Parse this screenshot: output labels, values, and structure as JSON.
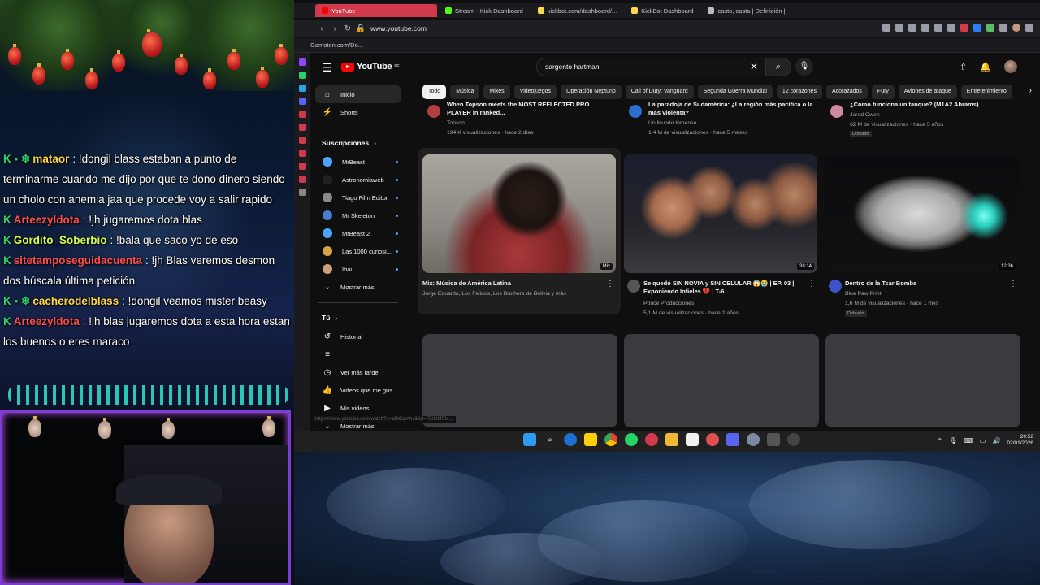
{
  "chat": {
    "messages": [
      {
        "badges": "K ▪ ❄",
        "user": "mataor",
        "user_color": "#ffd84a",
        "text": ": !dongil blass estaban a punto de terminarme cuando me dijo por que te dono dinero siendo un cholo con anemia jaa que procede voy a salir rapido"
      },
      {
        "badges": "K",
        "user": "Arteezyldota",
        "user_color": "#ff4d4d",
        "text": ": !jh jugaremos dota blas"
      },
      {
        "badges": "K",
        "user": "Gordito_Soberbio",
        "user_color": "#d7ff4a",
        "text": ": !bala que saco yo de eso"
      },
      {
        "badges": "K",
        "user": "sitetamposeguidacuenta",
        "user_color": "#ff4d4d",
        "text": ": !jh Blas veremos desmon dos búscala última petición"
      },
      {
        "badges": "K ▪ ❄",
        "user": "cacherodelblass",
        "user_color": "#ffd84a",
        "text": ": !dongil veamos mister beasy"
      },
      {
        "badges": "K",
        "user": "Arteezyldota",
        "user_color": "#ff4d4d",
        "text": ": !jh blas jugaremos dota a esta hora estan los buenos o eres maraco"
      }
    ]
  },
  "browser": {
    "tabs": [
      {
        "label": "YouTube",
        "active": true,
        "color": "#ff0000"
      },
      {
        "label": "Stream - Kick Dashboard",
        "active": false,
        "color": "#53fc18"
      },
      {
        "label": "kickbot.com/dashboard/...",
        "active": false,
        "color": "#ffd84a"
      },
      {
        "label": "KickBot Dashboard",
        "active": false,
        "color": "#ffd84a"
      },
      {
        "label": "casto, casta | Definición |",
        "active": false,
        "color": "#bbbbbb"
      }
    ],
    "url": "www.youtube.com",
    "bookmark": "Gamoten.com/Do..."
  },
  "youtube": {
    "logo": "YouTube",
    "country": "PE",
    "search_query": "sargento hartman",
    "guide": {
      "home": "Inicio",
      "shorts": "Shorts",
      "subs_title": "Suscripciones",
      "subscriptions": [
        {
          "name": "MrBeast",
          "color": "#4aa3ff"
        },
        {
          "name": "Astronomiaweb",
          "color": "#222222"
        },
        {
          "name": "Tiago Film Editor",
          "color": "#888888"
        },
        {
          "name": "Mr Skeleton",
          "color": "#4a7bd0"
        },
        {
          "name": "MrBeast 2",
          "color": "#4aa3ff"
        },
        {
          "name": "Las 1000 curiosi...",
          "color": "#d9a24a"
        },
        {
          "name": "Ibai",
          "color": "#c8a080"
        }
      ],
      "show_more": "Mostrar más",
      "you_title": "Tú",
      "history": "Historial",
      "watch_later": "Ver más tarde",
      "liked": "Videos que me gus...",
      "my_videos": "Mis videos",
      "show_more2": "Mostrar más"
    },
    "chips": [
      "Todo",
      "Música",
      "Mixes",
      "Videojuegos",
      "Operación Neptuno",
      "Call of Duty: Vanguard",
      "Segunda Guerra Mundial",
      "12 corazones",
      "Acorazados",
      "Fury",
      "Aviones de ataque",
      "Entretenimiento"
    ],
    "top_row": [
      {
        "title": "When Topson meets the MOST REFLECTED PRO PLAYER in ranked...",
        "channel": "Topson",
        "meta": "194 K visualizaciones · hace 2 días",
        "avatar": "#b34040"
      },
      {
        "title": "La paradoja de Sudamérica: ¿La región más pacífica o la más violenta?",
        "channel": "Un Mundo Inmenso",
        "meta": "1,4 M de visualizaciones · hace 5 meses",
        "avatar": "#2a6fd0"
      },
      {
        "title": "¿Cómo funciona un tanque? (M1A2 Abrams)",
        "channel": "Jared Owen",
        "meta": "62 M de visualizaciones · hace 5 años",
        "avatar": "#d08aa0",
        "badge": "Doblado"
      }
    ],
    "videos": [
      {
        "title": "Mix: Música de América Latina",
        "sub": "Jorge Eduardo, Los Felinos, Los Brothers de Bolivia y más",
        "duration": "Mix",
        "thumb": "mix"
      },
      {
        "title": "Se quedó SIN NOVIA y SIN CELULAR 😱😭 | EP. 03 | Exponiendo Infieles 💔 | T-6",
        "channel": "Ponce Producciones",
        "meta": "5,1 M de visualizaciones · hace 2 años",
        "duration": "38:14",
        "thumb": "people"
      },
      {
        "title": "Dentro de la Tsar Bomba",
        "channel": "Blue Paw Print",
        "meta": "1,6 M de visualizaciones · hace 1 mes",
        "duration": "12:36",
        "thumb": "bomb",
        "badge": "Doblado"
      }
    ],
    "status_url": "https://www.youtube.com/watch?v=aBtGqmhv&list=RDGMEM..."
  },
  "taskbar": {
    "time": "20:52",
    "date": "02/01/2026"
  }
}
